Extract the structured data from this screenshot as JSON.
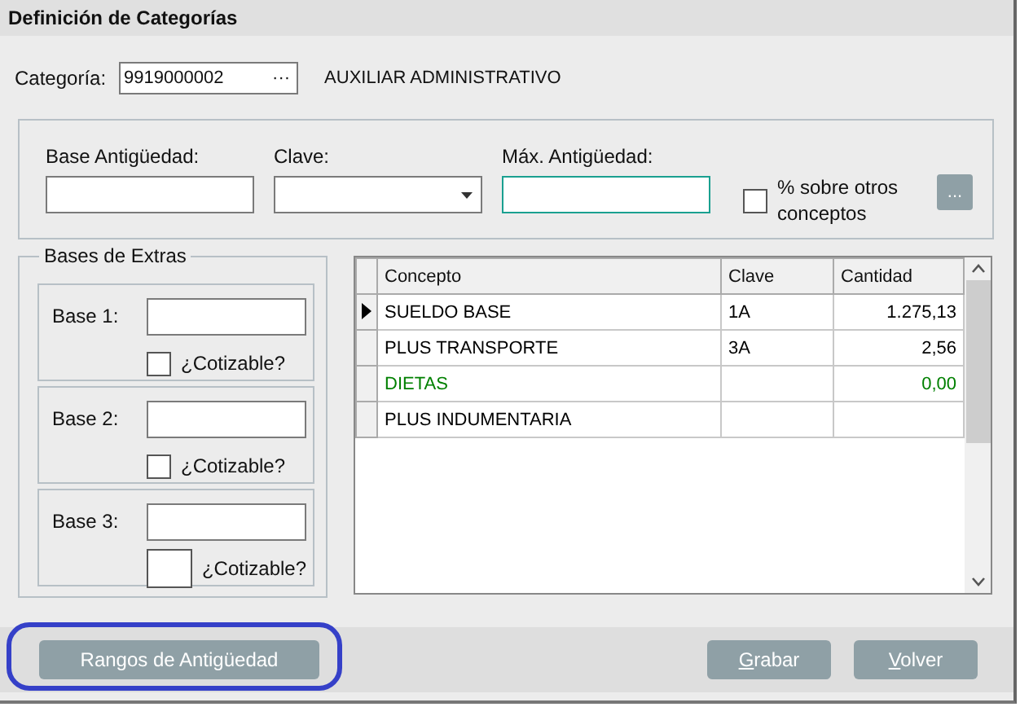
{
  "window": {
    "title": "Definición de Categorías"
  },
  "categoria": {
    "label": "Categoría:",
    "value": "9919000002",
    "lookup": "···",
    "description": "AUXILIAR ADMINISTRATIVO"
  },
  "antiguedad": {
    "base_label": "Base Antigüedad:",
    "clave_label": "Clave:",
    "max_label": "Máx. Antigüedad:",
    "max_focused": true,
    "percent_label": "% sobre otros conceptos",
    "percent_checked": false,
    "more_button": "..."
  },
  "bases_extras": {
    "title": "Bases de Extras",
    "bases": [
      {
        "label": "Base 1:",
        "cotizable_label": "¿Cotizable?",
        "checked": false,
        "kind": "small"
      },
      {
        "label": "Base 2:",
        "cotizable_label": "¿Cotizable?",
        "checked": false,
        "kind": "small"
      },
      {
        "label": "Base 3:",
        "cotizable_label": "¿Cotizable?",
        "checked": false,
        "kind": "large"
      }
    ]
  },
  "table": {
    "columns": [
      "Concepto",
      "Clave",
      "Cantidad"
    ],
    "rows": [
      {
        "concepto": "SUELDO BASE",
        "clave": "1A",
        "cantidad": "1.275,13",
        "current": true,
        "color": "#000000"
      },
      {
        "concepto": "PLUS TRANSPORTE",
        "clave": "3A",
        "cantidad": "2,56",
        "current": false,
        "color": "#000000"
      },
      {
        "concepto": "DIETAS",
        "clave": "",
        "cantidad": "0,00",
        "current": false,
        "color": "#008000"
      },
      {
        "concepto": "PLUS INDUMENTARIA",
        "clave": "",
        "cantidad": "",
        "current": false,
        "color": "#000000"
      }
    ]
  },
  "footer": {
    "buttons": [
      {
        "label": "Rangos de Antigüedad",
        "underline_first": false,
        "highlighted": true
      },
      {
        "label": "Grabar",
        "underline_first": true,
        "highlighted": false
      },
      {
        "label": "Volver",
        "underline_first": true,
        "highlighted": false
      }
    ]
  }
}
